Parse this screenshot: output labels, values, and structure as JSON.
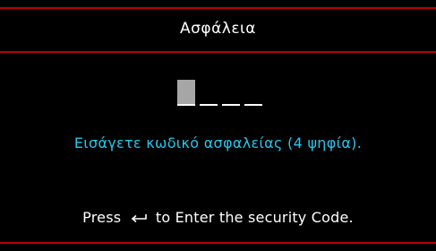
{
  "menu": {
    "title": "Ασφάλεια"
  },
  "security_code": {
    "digit_count": 4,
    "entered_count": 0,
    "active_index": 0,
    "instruction": "Εισάγετε κωδικό ασφαλείας (4 ψηφία)."
  },
  "hint": {
    "prefix": "Press",
    "icon": "enter-return-icon",
    "suffix": "to Enter the security Code."
  },
  "colors": {
    "background": "#000000",
    "divider": "#b8000a",
    "instruction_text": "#29c4ec",
    "cursor_block": "#a6a6a6"
  }
}
